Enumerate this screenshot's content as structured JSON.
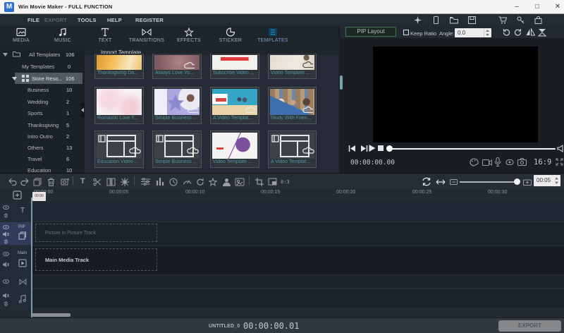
{
  "titlebar": {
    "logo_text": "M",
    "title": "Win Movie Maker - FULL FUNCTION"
  },
  "menubar": {
    "items": [
      {
        "label": "FILE",
        "disabled": false
      },
      {
        "label": "EXPORT",
        "disabled": true
      },
      {
        "label": "TOOLS",
        "disabled": false
      },
      {
        "label": "HELP",
        "disabled": false
      },
      {
        "label": "REGISTER",
        "disabled": false
      }
    ],
    "icons": [
      "effects-store-icon",
      "phone-icon",
      "folder-icon",
      "save-icon",
      "cart-icon",
      "key-icon",
      "bag-icon"
    ]
  },
  "tabs": [
    {
      "label": "MEDIA",
      "icon": "media-icon",
      "active": false
    },
    {
      "label": "MUSIC",
      "icon": "music-icon",
      "active": false
    },
    {
      "label": "TEXT",
      "icon": "text-icon",
      "active": false
    },
    {
      "label": "TRANSITIONS",
      "icon": "transitions-icon",
      "active": false
    },
    {
      "label": "EFFECTS",
      "icon": "effects-icon",
      "active": false
    },
    {
      "label": "STICKER",
      "icon": "sticker-icon",
      "active": false
    },
    {
      "label": "TEMPLATES",
      "icon": "templates-icon",
      "active": true
    }
  ],
  "library": {
    "tree": [
      {
        "label": "All Templates",
        "count": "106",
        "level": 0,
        "icon": "folder",
        "caret": true,
        "selected": false
      },
      {
        "label": "My Templates",
        "count": "0",
        "level": 0,
        "icon": "",
        "caret": false,
        "selected": false
      },
      {
        "label": "Store Reso...",
        "count": "106",
        "level": 0,
        "icon": "grid",
        "caret": true,
        "selected": true
      },
      {
        "label": "Business",
        "count": "10",
        "level": 1,
        "selected": false
      },
      {
        "label": "Wedding",
        "count": "2",
        "level": 1,
        "selected": false
      },
      {
        "label": "Sports",
        "count": "1",
        "level": 1,
        "selected": false
      },
      {
        "label": "Thanksgiving",
        "count": "5",
        "level": 1,
        "selected": false
      },
      {
        "label": "Intro Outro",
        "count": "2",
        "level": 1,
        "selected": false
      },
      {
        "label": "Others",
        "count": "13",
        "level": 1,
        "selected": false
      },
      {
        "label": "Travel",
        "count": "6",
        "level": 1,
        "selected": false
      },
      {
        "label": "Education",
        "count": "10",
        "level": 1,
        "selected": false
      }
    ],
    "panel_header": "Import Template",
    "templates": [
      {
        "name": "Thanksgiving Da...",
        "kind": "photo",
        "cloud": false
      },
      {
        "name": "Always Love Yo...",
        "kind": "photo",
        "cloud": true
      },
      {
        "name": "Subscribe Video ...",
        "kind": "photo",
        "cloud": false
      },
      {
        "name": "Video Template ...",
        "kind": "photo",
        "cloud": true
      },
      {
        "name": "Romantic Love T...",
        "kind": "photo",
        "cloud": false
      },
      {
        "name": "Simple Business ...",
        "kind": "photo",
        "cloud": true
      },
      {
        "name": "A Video Templat...",
        "kind": "photo",
        "cloud": true
      },
      {
        "name": "Study With Frien...",
        "kind": "photo",
        "cloud": true
      },
      {
        "name": "Education Video ...",
        "kind": "placeholder",
        "cloud": true
      },
      {
        "name": "Simple Business ...",
        "kind": "placeholder",
        "cloud": true
      },
      {
        "name": "Video Template ...",
        "kind": "photo",
        "cloud": false
      },
      {
        "name": "A Video Templat...",
        "kind": "placeholder",
        "cloud": true
      }
    ]
  },
  "preview": {
    "pip_layout_button": "PIP Layout",
    "keep_ratio_label": "Keep Ratio",
    "keep_ratio_checked": false,
    "angle_label": "Angle:",
    "angle_value": "0.0",
    "current_time": "00:00:00.00",
    "aspect_ratio": "16:9"
  },
  "timeline": {
    "toolbar_icons": [
      "undo",
      "redo",
      "copy",
      "delete",
      "record",
      "add-text",
      "split",
      "trim",
      "freeze",
      "adjust",
      "mixer",
      "duration",
      "speed",
      "rotate",
      "effects",
      "portrait",
      "green-screen",
      "crop",
      "pip",
      "beat"
    ],
    "zoom_icons": [
      "sync",
      "fit",
      "zoom-out",
      "zoom-in"
    ],
    "zoom_duration": "00:05",
    "ruler_labels": [
      "00:00:00",
      "00:00:05",
      "00:00:10",
      "00:00:15",
      "00:00:20",
      "00:00:25",
      "00:00:30"
    ],
    "playhead_flag": "00:00",
    "tracks": [
      {
        "name": "T",
        "type": "text",
        "placeholder": "",
        "selected": false
      },
      {
        "name": "PIP",
        "type": "pip",
        "placeholder": "Picture in Picture Track",
        "selected": true
      },
      {
        "name": "Main",
        "type": "video",
        "placeholder": "Main Media Track",
        "selected": false
      },
      {
        "name": "",
        "type": "transition",
        "placeholder": "",
        "selected": false
      },
      {
        "name": "",
        "type": "audio",
        "placeholder": "",
        "selected": false
      }
    ]
  },
  "statusbar": {
    "project_name": "UNTITLED_0",
    "timecode": "00:00:00.01",
    "export_button": "EXPORT"
  }
}
